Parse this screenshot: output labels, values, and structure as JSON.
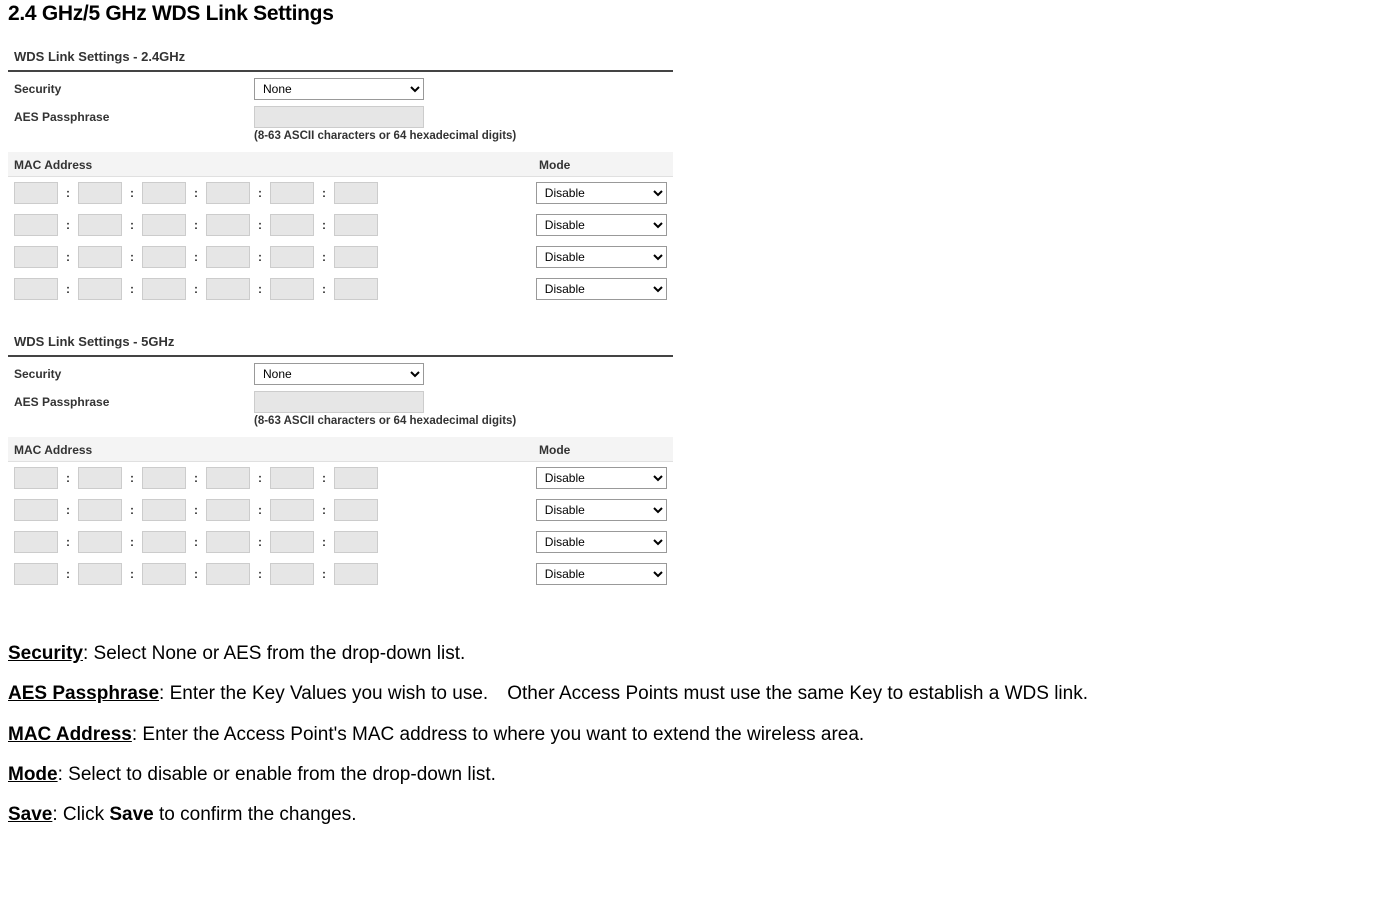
{
  "heading": "2.4 GHz/5 GHz WDS Link Settings",
  "panels": [
    {
      "title": "WDS Link Settings - 2.4GHz",
      "security_label": "Security",
      "security_value": "None",
      "aes_label": "AES Passphrase",
      "aes_hint": "(8-63 ASCII characters or 64 hexadecimal digits)",
      "mac_header": "MAC Address",
      "mode_header": "Mode",
      "rows": [
        "Disable",
        "Disable",
        "Disable",
        "Disable"
      ]
    },
    {
      "title": "WDS Link Settings - 5GHz",
      "security_label": "Security",
      "security_value": "None",
      "aes_label": "AES Passphrase",
      "aes_hint": "(8-63 ASCII characters or 64 hexadecimal digits)",
      "mac_header": "MAC Address",
      "mode_header": "Mode",
      "rows": [
        "Disable",
        "Disable",
        "Disable",
        "Disable"
      ]
    }
  ],
  "desc_security_term": "Security",
  "desc_security": ": Select None or AES from the drop-down list.",
  "desc_aes_term": "AES Passphrase",
  "desc_aes": ": Enter the Key Values you wish to use. Other Access Points must use the same Key to establish a WDS link.",
  "desc_mac_term": "MAC Address",
  "desc_mac": ": Enter the Access Point's MAC address to where you want to extend the wireless area.",
  "desc_mode_term": "Mode",
  "desc_mode": ": Select to disable or enable from the drop-down list.",
  "desc_save_term": "Save",
  "desc_save_1": ": Click ",
  "desc_save_bold": "Save",
  "desc_save_2": " to confirm the changes."
}
